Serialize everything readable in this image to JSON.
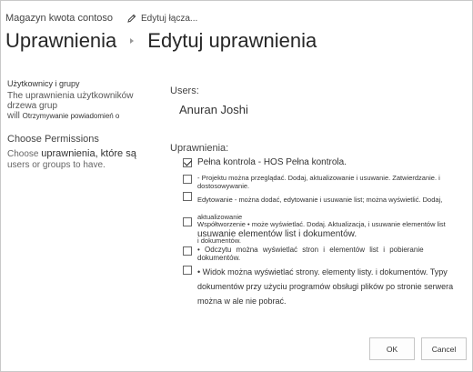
{
  "header": {
    "site_name": "Magazyn kwota contoso",
    "edit_link": "Edytuj łącza...",
    "title": "Uprawnienia",
    "subtitle": "Edytuj uprawnienia"
  },
  "users_section": {
    "heading": "Użytkownicy i grupy",
    "desc_part1": "The",
    "desc_part2": "uprawnienia użytkowników drzewa grup",
    "desc_part3": "will",
    "desc_part4": "Otrzymywanie powiadomień o"
  },
  "permissions_section": {
    "heading": "Choose Permissions",
    "desc_part1": "Choose",
    "desc_part2": "uprawnienia, które są",
    "desc_part3": "users or groups to have."
  },
  "users": {
    "label": "Users:",
    "name": "Anuran Joshi"
  },
  "permissions": {
    "label": "Uprawnienia:",
    "items": [
      {
        "checked": true,
        "text": "Pełna kontrola - HOS Pełna kontrola."
      },
      {
        "checked": false,
        "text": "- Projektu można przeglądać. Dodaj, aktualizowanie i usuwanie. Zatwierdzanie. i dostosowywanie."
      },
      {
        "checked": false,
        "line1": "Edytowanie - można dodać, edytowanie i usuwanie list; można wyświetlić. Dodaj, aktualizowanie",
        "line2": "usuwanie elementów list i dokumentów."
      },
      {
        "checked": false,
        "line1": "Współtworzenie • może wyświetlać. Dodaj. Aktualizacja, i usuwanie elementów list",
        "line2": "i dokumentów."
      },
      {
        "checked": false,
        "text": "• Odczytu można wyświetlać stron i elementów list i pobieranie dokumentów."
      },
      {
        "checked": false,
        "line1": "• Widok można wyświetlać strony. elementy listy. i dokumentów. Typy",
        "line2": "dokumentów przy użyciu programów obsługi plików po stronie serwera",
        "line3": "można w ale nie pobrać."
      }
    ]
  },
  "buttons": {
    "ok": "OK",
    "cancel": "Cancel"
  }
}
